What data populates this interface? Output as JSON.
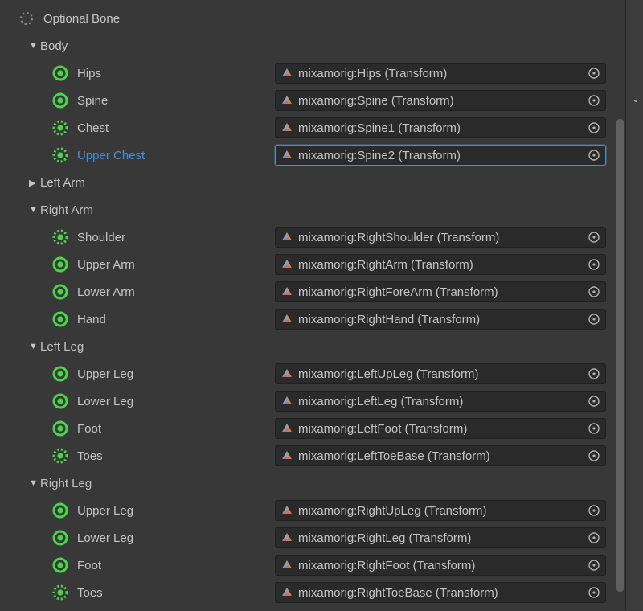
{
  "header": {
    "label": "Optional Bone"
  },
  "sections": [
    {
      "label": "Body",
      "expanded": true,
      "bones": [
        {
          "name": "Hips",
          "optional": false,
          "selected": false,
          "value": "mixamorig:Hips (Transform)"
        },
        {
          "name": "Spine",
          "optional": false,
          "selected": false,
          "value": "mixamorig:Spine (Transform)"
        },
        {
          "name": "Chest",
          "optional": true,
          "selected": false,
          "value": "mixamorig:Spine1 (Transform)"
        },
        {
          "name": "Upper Chest",
          "optional": true,
          "selected": true,
          "value": "mixamorig:Spine2 (Transform)"
        }
      ]
    },
    {
      "label": "Left Arm",
      "expanded": false,
      "bones": []
    },
    {
      "label": "Right Arm",
      "expanded": true,
      "bones": [
        {
          "name": "Shoulder",
          "optional": true,
          "selected": false,
          "value": "mixamorig:RightShoulder (Transform)"
        },
        {
          "name": "Upper Arm",
          "optional": false,
          "selected": false,
          "value": "mixamorig:RightArm (Transform)"
        },
        {
          "name": "Lower Arm",
          "optional": false,
          "selected": false,
          "value": "mixamorig:RightForeArm (Transform)"
        },
        {
          "name": "Hand",
          "optional": false,
          "selected": false,
          "value": "mixamorig:RightHand (Transform)"
        }
      ]
    },
    {
      "label": "Left Leg",
      "expanded": true,
      "bones": [
        {
          "name": "Upper Leg",
          "optional": false,
          "selected": false,
          "value": "mixamorig:LeftUpLeg (Transform)"
        },
        {
          "name": "Lower Leg",
          "optional": false,
          "selected": false,
          "value": "mixamorig:LeftLeg (Transform)"
        },
        {
          "name": "Foot",
          "optional": false,
          "selected": false,
          "value": "mixamorig:LeftFoot (Transform)"
        },
        {
          "name": "Toes",
          "optional": true,
          "selected": false,
          "value": "mixamorig:LeftToeBase (Transform)"
        }
      ]
    },
    {
      "label": "Right Leg",
      "expanded": true,
      "bones": [
        {
          "name": "Upper Leg",
          "optional": false,
          "selected": false,
          "value": "mixamorig:RightUpLeg (Transform)"
        },
        {
          "name": "Lower Leg",
          "optional": false,
          "selected": false,
          "value": "mixamorig:RightLeg (Transform)"
        },
        {
          "name": "Foot",
          "optional": false,
          "selected": false,
          "value": "mixamorig:RightFoot (Transform)"
        },
        {
          "name": "Toes",
          "optional": true,
          "selected": false,
          "value": "mixamorig:RightToeBase (Transform)"
        }
      ]
    }
  ]
}
